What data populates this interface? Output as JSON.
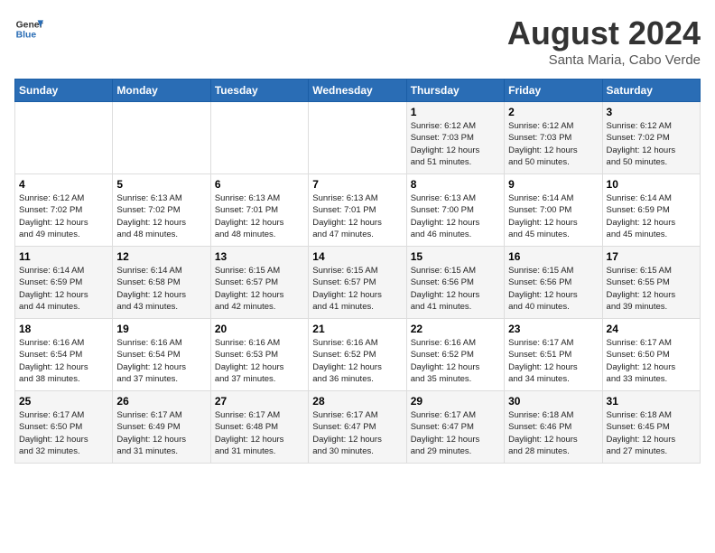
{
  "header": {
    "logo_line1": "General",
    "logo_line2": "Blue",
    "month_year": "August 2024",
    "location": "Santa Maria, Cabo Verde"
  },
  "weekdays": [
    "Sunday",
    "Monday",
    "Tuesday",
    "Wednesday",
    "Thursday",
    "Friday",
    "Saturday"
  ],
  "weeks": [
    [
      {
        "day": "",
        "info": ""
      },
      {
        "day": "",
        "info": ""
      },
      {
        "day": "",
        "info": ""
      },
      {
        "day": "",
        "info": ""
      },
      {
        "day": "1",
        "info": "Sunrise: 6:12 AM\nSunset: 7:03 PM\nDaylight: 12 hours\nand 51 minutes."
      },
      {
        "day": "2",
        "info": "Sunrise: 6:12 AM\nSunset: 7:03 PM\nDaylight: 12 hours\nand 50 minutes."
      },
      {
        "day": "3",
        "info": "Sunrise: 6:12 AM\nSunset: 7:02 PM\nDaylight: 12 hours\nand 50 minutes."
      }
    ],
    [
      {
        "day": "4",
        "info": "Sunrise: 6:12 AM\nSunset: 7:02 PM\nDaylight: 12 hours\nand 49 minutes."
      },
      {
        "day": "5",
        "info": "Sunrise: 6:13 AM\nSunset: 7:02 PM\nDaylight: 12 hours\nand 48 minutes."
      },
      {
        "day": "6",
        "info": "Sunrise: 6:13 AM\nSunset: 7:01 PM\nDaylight: 12 hours\nand 48 minutes."
      },
      {
        "day": "7",
        "info": "Sunrise: 6:13 AM\nSunset: 7:01 PM\nDaylight: 12 hours\nand 47 minutes."
      },
      {
        "day": "8",
        "info": "Sunrise: 6:13 AM\nSunset: 7:00 PM\nDaylight: 12 hours\nand 46 minutes."
      },
      {
        "day": "9",
        "info": "Sunrise: 6:14 AM\nSunset: 7:00 PM\nDaylight: 12 hours\nand 45 minutes."
      },
      {
        "day": "10",
        "info": "Sunrise: 6:14 AM\nSunset: 6:59 PM\nDaylight: 12 hours\nand 45 minutes."
      }
    ],
    [
      {
        "day": "11",
        "info": "Sunrise: 6:14 AM\nSunset: 6:59 PM\nDaylight: 12 hours\nand 44 minutes."
      },
      {
        "day": "12",
        "info": "Sunrise: 6:14 AM\nSunset: 6:58 PM\nDaylight: 12 hours\nand 43 minutes."
      },
      {
        "day": "13",
        "info": "Sunrise: 6:15 AM\nSunset: 6:57 PM\nDaylight: 12 hours\nand 42 minutes."
      },
      {
        "day": "14",
        "info": "Sunrise: 6:15 AM\nSunset: 6:57 PM\nDaylight: 12 hours\nand 41 minutes."
      },
      {
        "day": "15",
        "info": "Sunrise: 6:15 AM\nSunset: 6:56 PM\nDaylight: 12 hours\nand 41 minutes."
      },
      {
        "day": "16",
        "info": "Sunrise: 6:15 AM\nSunset: 6:56 PM\nDaylight: 12 hours\nand 40 minutes."
      },
      {
        "day": "17",
        "info": "Sunrise: 6:15 AM\nSunset: 6:55 PM\nDaylight: 12 hours\nand 39 minutes."
      }
    ],
    [
      {
        "day": "18",
        "info": "Sunrise: 6:16 AM\nSunset: 6:54 PM\nDaylight: 12 hours\nand 38 minutes."
      },
      {
        "day": "19",
        "info": "Sunrise: 6:16 AM\nSunset: 6:54 PM\nDaylight: 12 hours\nand 37 minutes."
      },
      {
        "day": "20",
        "info": "Sunrise: 6:16 AM\nSunset: 6:53 PM\nDaylight: 12 hours\nand 37 minutes."
      },
      {
        "day": "21",
        "info": "Sunrise: 6:16 AM\nSunset: 6:52 PM\nDaylight: 12 hours\nand 36 minutes."
      },
      {
        "day": "22",
        "info": "Sunrise: 6:16 AM\nSunset: 6:52 PM\nDaylight: 12 hours\nand 35 minutes."
      },
      {
        "day": "23",
        "info": "Sunrise: 6:17 AM\nSunset: 6:51 PM\nDaylight: 12 hours\nand 34 minutes."
      },
      {
        "day": "24",
        "info": "Sunrise: 6:17 AM\nSunset: 6:50 PM\nDaylight: 12 hours\nand 33 minutes."
      }
    ],
    [
      {
        "day": "25",
        "info": "Sunrise: 6:17 AM\nSunset: 6:50 PM\nDaylight: 12 hours\nand 32 minutes."
      },
      {
        "day": "26",
        "info": "Sunrise: 6:17 AM\nSunset: 6:49 PM\nDaylight: 12 hours\nand 31 minutes."
      },
      {
        "day": "27",
        "info": "Sunrise: 6:17 AM\nSunset: 6:48 PM\nDaylight: 12 hours\nand 31 minutes."
      },
      {
        "day": "28",
        "info": "Sunrise: 6:17 AM\nSunset: 6:47 PM\nDaylight: 12 hours\nand 30 minutes."
      },
      {
        "day": "29",
        "info": "Sunrise: 6:17 AM\nSunset: 6:47 PM\nDaylight: 12 hours\nand 29 minutes."
      },
      {
        "day": "30",
        "info": "Sunrise: 6:18 AM\nSunset: 6:46 PM\nDaylight: 12 hours\nand 28 minutes."
      },
      {
        "day": "31",
        "info": "Sunrise: 6:18 AM\nSunset: 6:45 PM\nDaylight: 12 hours\nand 27 minutes."
      }
    ]
  ]
}
